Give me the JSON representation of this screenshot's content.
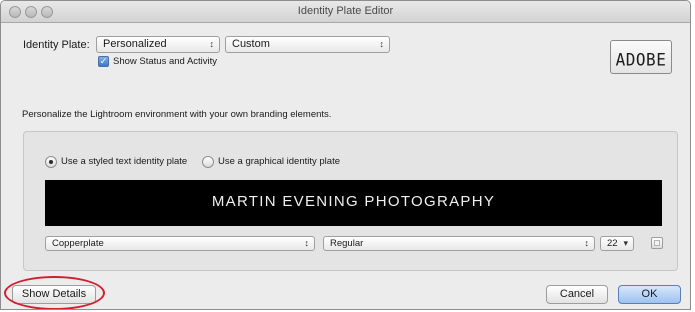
{
  "window": {
    "title": "Identity Plate Editor"
  },
  "identity_plate": {
    "label": "Identity Plate:",
    "mode_value": "Personalized",
    "preset_value": "Custom",
    "show_status_label": "Show Status and Activity",
    "show_status_checked": true,
    "preview_text": "ADOBE"
  },
  "description": "Personalize the Lightroom environment with your own branding elements.",
  "plate_type": {
    "options": [
      {
        "label": "Use a styled text identity plate",
        "selected": true
      },
      {
        "label": "Use a graphical identity plate",
        "selected": false
      }
    ]
  },
  "banner": {
    "text": "MARTIN EVENING PHOTOGRAPHY"
  },
  "font": {
    "family": "Copperplate",
    "style": "Regular",
    "size": "22"
  },
  "buttons": {
    "show_details": "Show Details",
    "cancel": "Cancel",
    "ok": "OK"
  },
  "colors": {
    "highlight_ring": "#d02030",
    "default_button": "#9ec2ef",
    "banner_bg": "#000000"
  }
}
